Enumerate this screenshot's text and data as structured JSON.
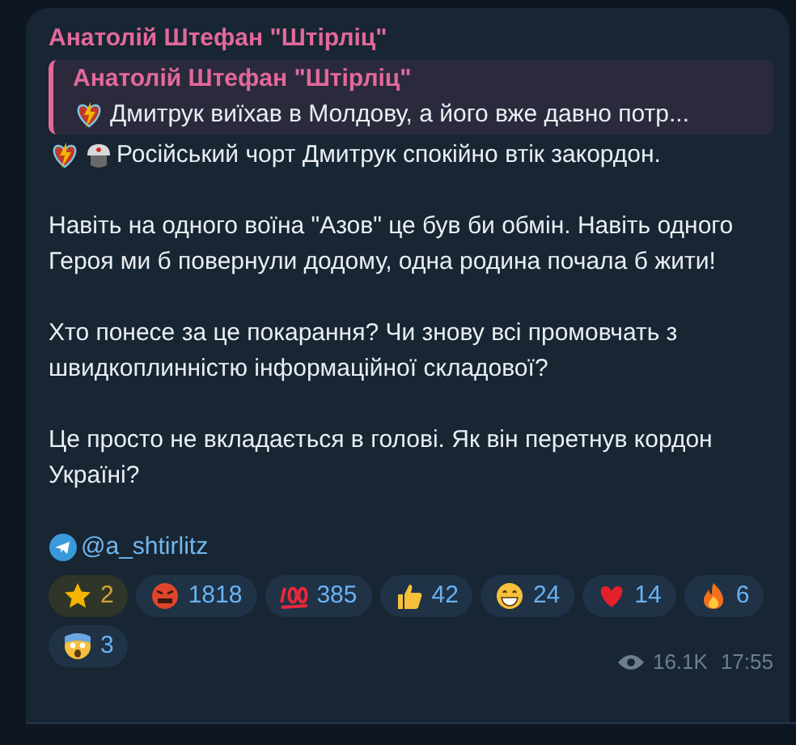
{
  "message": {
    "author": "Анатолій Штефан \"Штірліц\"",
    "reply": {
      "author": "Анатолій Штефан \"Штірліц\"",
      "text": "Дмитрук виїхав в Молдову, а його вже давно потр..."
    },
    "paragraphs": [
      "Російський чорт Дмитрук спокійно втік закордон.",
      "Навіть на одного воїна \"Азов\" це був би обмін. Навіть одного Героя ми б повернули додому, одна родина почала б жити!",
      "Хто понесе за це покарання? Чи знову всі промовчать з швидкоплинністю інформаційної складової?",
      "Це просто не вкладається в голові. Як він перетнув кордон Україні?"
    ],
    "link": "@a_shtirlitz",
    "reactions": [
      {
        "kind": "star",
        "count": "2"
      },
      {
        "kind": "angry",
        "count": "1818"
      },
      {
        "kind": "hundred",
        "count": "385"
      },
      {
        "kind": "thumbs-up",
        "count": "42"
      },
      {
        "kind": "grin",
        "count": "24"
      },
      {
        "kind": "heart",
        "count": "14"
      },
      {
        "kind": "fire",
        "count": "6"
      },
      {
        "kind": "scream",
        "count": "3"
      }
    ],
    "views": "16.1K",
    "time": "17:55"
  }
}
